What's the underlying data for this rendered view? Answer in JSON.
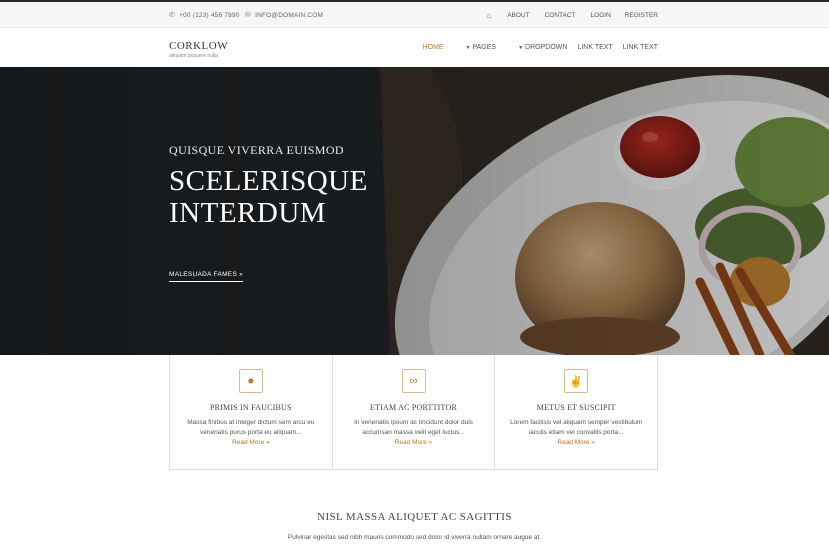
{
  "topbar": {
    "phone": "+00 (123) 456 7890",
    "email": "INFO@DOMAIN.COM",
    "nav": [
      "ABOUT",
      "CONTACT",
      "LOGIN",
      "REGISTER"
    ]
  },
  "header": {
    "brand": "CORKLOW",
    "tagline": "aliquam posuere nulla",
    "nav": {
      "home": "HOME",
      "pages": "PAGES",
      "dropdown": "DROPDOWN",
      "link1": "LINK TEXT",
      "link2": "LINK TEXT"
    }
  },
  "hero": {
    "kicker": "QUISQUE VIVERRA EUISMOD",
    "title": "SCELERISQUE INTERDUM",
    "cta": "MALESUADA FAMES »"
  },
  "features": [
    {
      "icon": "key-icon",
      "title": "PRIMIS IN FAUCIBUS",
      "text": "Massa finibus at integer dictum sem arcu eu venenatis purus porta eu aliquam...",
      "more": "Read More »"
    },
    {
      "icon": "infinity-icon",
      "title": "ETIAM AC PORTTITOR",
      "text": "In venenatis ipsum ac tincidunt dolor duis accumsan massa velit eget luctus...",
      "more": "Read More »"
    },
    {
      "icon": "victory-hand-icon",
      "title": "METUS ET SUSCIPIT",
      "text": "Lorem facilisis vel aliquam semper vestibulum iaculis etiam vel convallis porta...",
      "more": "Read More »"
    }
  ],
  "section": {
    "title": "NISL MASSA ALIQUET AC SAGITTIS",
    "text": "Pulvinar egestas sed nibh mauris commodo sed dolor id viverra nullam ornare augue at."
  },
  "colors": {
    "accent": "#c0762a",
    "topbar_bg": "#f6f6f6",
    "hero_dark": "#1d2022"
  }
}
